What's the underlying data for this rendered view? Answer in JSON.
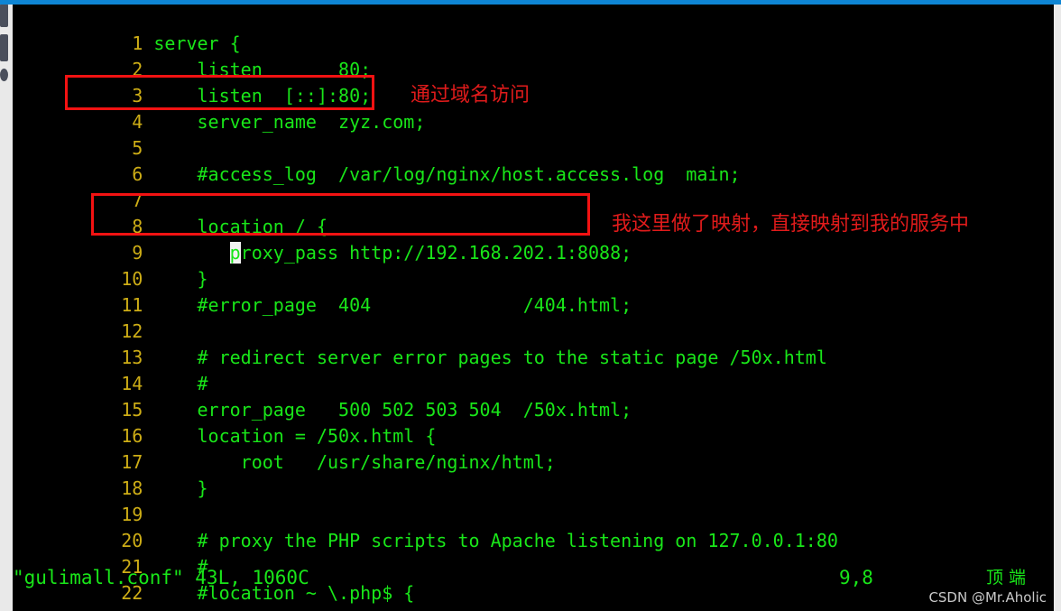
{
  "window": {
    "top_bar_color": "#0e85d4",
    "chrome_color": "#e9e9e9",
    "terminal_bg": "#000000"
  },
  "editor": {
    "name": "vim",
    "text_color": "#19e619",
    "lineno_color": "#cdad16",
    "cursor_line": 9,
    "cursor_col": 8,
    "lines": [
      {
        "n": "1",
        "text": "server {"
      },
      {
        "n": "2",
        "text": "    listen       80;"
      },
      {
        "n": "3",
        "text": "    listen  [::]:80;"
      },
      {
        "n": "4",
        "text": "    server_name  zyz.com;"
      },
      {
        "n": "5",
        "text": ""
      },
      {
        "n": "6",
        "text": "    #access_log  /var/log/nginx/host.access.log  main;"
      },
      {
        "n": "7",
        "text": ""
      },
      {
        "n": "8",
        "text": "    location / {"
      },
      {
        "n": "9",
        "text": "       proxy_pass http://192.168.202.1:8088;"
      },
      {
        "n": "10",
        "text": "    }"
      },
      {
        "n": "11",
        "text": "    #error_page  404              /404.html;"
      },
      {
        "n": "12",
        "text": ""
      },
      {
        "n": "13",
        "text": "    # redirect server error pages to the static page /50x.html"
      },
      {
        "n": "14",
        "text": "    #"
      },
      {
        "n": "15",
        "text": "    error_page   500 502 503 504  /50x.html;"
      },
      {
        "n": "16",
        "text": "    location = /50x.html {"
      },
      {
        "n": "17",
        "text": "        root   /usr/share/nginx/html;"
      },
      {
        "n": "18",
        "text": "    }"
      },
      {
        "n": "19",
        "text": ""
      },
      {
        "n": "20",
        "text": "    # proxy the PHP scripts to Apache listening on 127.0.0.1:80"
      },
      {
        "n": "21",
        "text": "    #"
      },
      {
        "n": "22",
        "text": "    #location ~ \\.php$ {"
      }
    ],
    "cursor_line_parts": {
      "before": "       ",
      "cursor": "p",
      "after": "roxy_pass http://192.168.202.1:8088;"
    }
  },
  "annotations": {
    "color": "#e01b1b",
    "domain_note": "通过域名访问",
    "proxy_note": "我这里做了映射，直接映射到我的服务中"
  },
  "status": {
    "file": "\"gulimall.conf\" 43L, 1060C",
    "position": "9,8",
    "state": "顶 端"
  },
  "watermark": {
    "text": "CSDN @Mr.Aholic"
  }
}
